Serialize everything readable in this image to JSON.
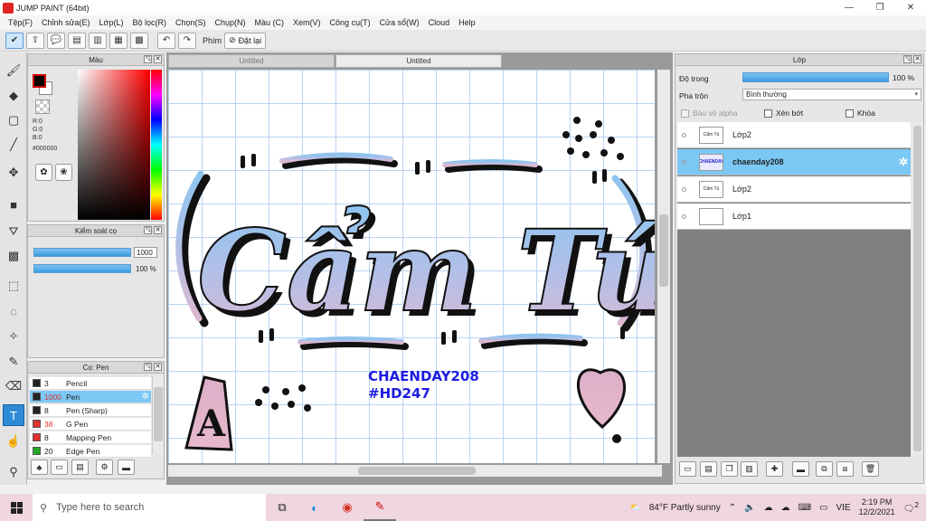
{
  "window": {
    "title": "JUMP PAINT (64bit)",
    "controls": [
      "—",
      "❐",
      "✕"
    ]
  },
  "menu": [
    "Tệp(F)",
    "Chỉnh sửa(E)",
    "Lớp(L)",
    "Bộ lọc(R)",
    "Chọn(S)",
    "Chụp(N)",
    "Màu (C)",
    "Xem(V)",
    "Công cụ(T)",
    "Cửa sổ(W)",
    "Cloud",
    "Help"
  ],
  "toolbar": {
    "phim_label": "Phím",
    "reset_label": "Đặt lại"
  },
  "color_panel": {
    "title": "Màu",
    "r": "R:0",
    "g": "G:0",
    "b": "B:0",
    "hex": "#000000",
    "fg_color": "#000000",
    "bg_color": "#ffffff"
  },
  "brush_control": {
    "title": "Kiểm soát cọ",
    "size_value": "1000",
    "opacity_value": "100 %"
  },
  "pen_panel": {
    "title": "Cọ: Pen",
    "items": [
      {
        "size": "3",
        "name": "Pencil",
        "color": "#222222"
      },
      {
        "size": "1000",
        "name": "Pen",
        "color": "#222222"
      },
      {
        "size": "8",
        "name": "Pen (Sharp)",
        "color": "#222222"
      },
      {
        "size": "38",
        "name": "G Pen",
        "color": "#e03030"
      },
      {
        "size": "8",
        "name": "Mapping Pen",
        "color": "#e03030"
      },
      {
        "size": "20",
        "name": "Edge Pen",
        "color": "#22aa22"
      }
    ]
  },
  "document": {
    "tabs": [
      "Untitled",
      "Untitled"
    ],
    "artwork_text": "Cẩm Tú",
    "watermark_line1": "CHAENDAY208",
    "watermark_line2": "#HD247"
  },
  "layer_panel": {
    "title": "Lớp",
    "opacity_label": "Độ trong",
    "opacity_value": "100 %",
    "blend_label": "Pha trộn",
    "blend_value": "Bình thường",
    "protect_alpha": "Bảo vệ alpha",
    "clip": "Xén bớt",
    "lock": "Khóa",
    "layers": [
      {
        "name": "Lớp2",
        "thumb": "Cẩm Tú"
      },
      {
        "name": "chaenday208",
        "thumb": "CHAENDAY"
      },
      {
        "name": "Lớp2",
        "thumb": "Cẩm Tú"
      },
      {
        "name": "Lớp1",
        "thumb": ""
      }
    ]
  },
  "taskbar": {
    "search_placeholder": "Type here to search",
    "weather": "84°F  Partly sunny",
    "lang": "VIE",
    "time": "2:19 PM",
    "date": "12/2/2021",
    "notification_count": "2"
  }
}
